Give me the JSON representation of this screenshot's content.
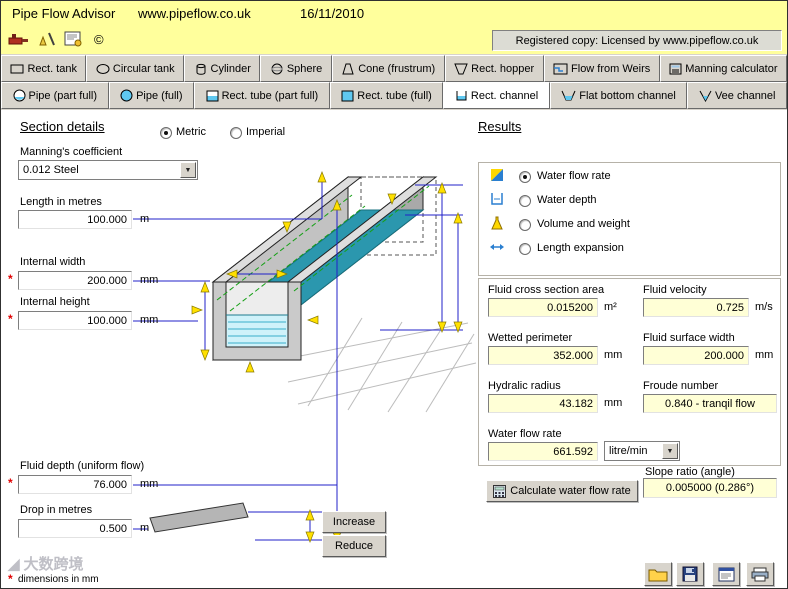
{
  "titlebar": {
    "app": "Pipe Flow Advisor",
    "site": "www.pipeflow.co.uk",
    "date": "16/11/2010"
  },
  "toolbar": {
    "registered": "Registered copy: Licensed by www.pipeflow.co.uk",
    "copyright_symbol": "©"
  },
  "tabs": {
    "row1": [
      "Rect. tank",
      "Circular tank",
      "Cylinder",
      "Sphere",
      "Cone (frustrum)",
      "Rect. hopper",
      "Flow from Weirs",
      "Manning calculator"
    ],
    "row2": [
      "Pipe (part full)",
      "Pipe (full)",
      "Rect. tube (part full)",
      "Rect. tube (full)",
      "Rect. channel",
      "Flat bottom channel",
      "Vee channel"
    ],
    "active_tab": "Rect. channel"
  },
  "section": {
    "heading": "Section details",
    "unit_metric": "Metric",
    "unit_imperial": "Imperial",
    "selected_units": "Metric",
    "manning_label": "Manning's coefficient",
    "manning_value": "0.012  Steel",
    "fields": [
      {
        "label": "Length  in metres",
        "value": "100.000",
        "unit": "m"
      },
      {
        "label": "Internal width",
        "value": "200.000",
        "unit": "mm",
        "required": "*"
      },
      {
        "label": "Internal height",
        "value": "100.000",
        "unit": "mm",
        "required": "*"
      },
      {
        "label": "Fluid depth (uniform flow)",
        "value": "76.000",
        "unit": "mm",
        "required": "*"
      },
      {
        "label": "Drop  in metres",
        "value": "0.500",
        "unit": "m"
      }
    ],
    "increase": "Increase",
    "reduce": "Reduce",
    "footnote_star": "*",
    "footnote": "dimensions in mm"
  },
  "results": {
    "heading": "Results",
    "options": [
      "Water flow rate",
      "Water depth",
      "Volume and weight",
      "Length expansion"
    ],
    "selected_option": "Water flow rate",
    "fields": [
      {
        "label": "Fluid cross section area",
        "value": "0.015200",
        "unit": "m²"
      },
      {
        "label": "Fluid velocity",
        "value": "0.725",
        "unit": "m/s"
      },
      {
        "label": "Wetted perimeter",
        "value": "352.000",
        "unit": "mm"
      },
      {
        "label": "Fluid surface width",
        "value": "200.000",
        "unit": "mm"
      },
      {
        "label": "Hydralic radius",
        "value": "43.182",
        "unit": "mm"
      },
      {
        "label": "Froude number",
        "value": "0.840 - tranqil flow",
        "unit": ""
      },
      {
        "label": "Water flow rate",
        "value": "661.592",
        "unit": "litre/min"
      }
    ],
    "calculate": "Calculate water flow rate",
    "slope_label": "Slope ratio (angle)",
    "slope_value": "0.005000 (0.286°)"
  },
  "watermark": "大数跨境"
}
